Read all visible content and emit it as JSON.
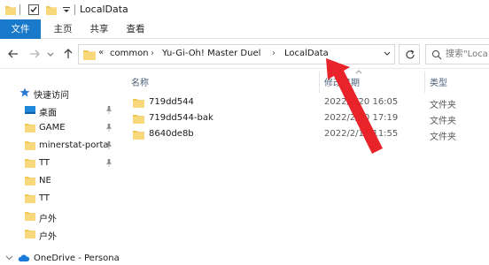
{
  "window": {
    "title": "LocalData"
  },
  "ribbon": {
    "tabs": [
      "文件",
      "主页",
      "共享",
      "查看"
    ]
  },
  "address_bar": {
    "overflow": "«",
    "crumbs": [
      "common",
      "Yu-Gi-Oh!  Master Duel",
      "LocalData"
    ],
    "separator": "›"
  },
  "search": {
    "placeholder": "搜索\"Loca"
  },
  "sidebar": {
    "items": [
      {
        "label": "快速访问",
        "icon": "star-icon",
        "pinned": false
      },
      {
        "label": "桌面",
        "icon": "desktop-folder-icon",
        "pinned": true
      },
      {
        "label": "GAME",
        "icon": "folder-icon",
        "pinned": true
      },
      {
        "label": "minerstat-porta",
        "icon": "folder-icon",
        "pinned": true
      },
      {
        "label": "TT",
        "icon": "folder-icon",
        "pinned": true
      },
      {
        "label": "NE",
        "icon": "folder-icon",
        "pinned": false
      },
      {
        "label": "TT",
        "icon": "folder-icon",
        "pinned": false
      },
      {
        "label": "户外",
        "icon": "folder-icon",
        "pinned": false
      },
      {
        "label": "户外",
        "icon": "folder-icon",
        "pinned": false
      },
      {
        "label": "OneDrive - Persona",
        "icon": "onedrive-cloud-icon",
        "pinned": false
      }
    ]
  },
  "file_list": {
    "columns": {
      "name": "名称",
      "date": "修改日期",
      "type": "类型"
    },
    "rows": [
      {
        "name": "719dd544",
        "date": "2022/2/20 16:05",
        "type": "文件夹"
      },
      {
        "name": "719dd544-bak",
        "date": "2022/2/20 17:19",
        "type": "文件夹"
      },
      {
        "name": "8640de8b",
        "date": "2022/2/19 11:55",
        "type": "文件夹"
      }
    ]
  },
  "colors": {
    "accent": "#1979ca",
    "folder": "#f3c552",
    "annotation_arrow": "#e8232a"
  }
}
